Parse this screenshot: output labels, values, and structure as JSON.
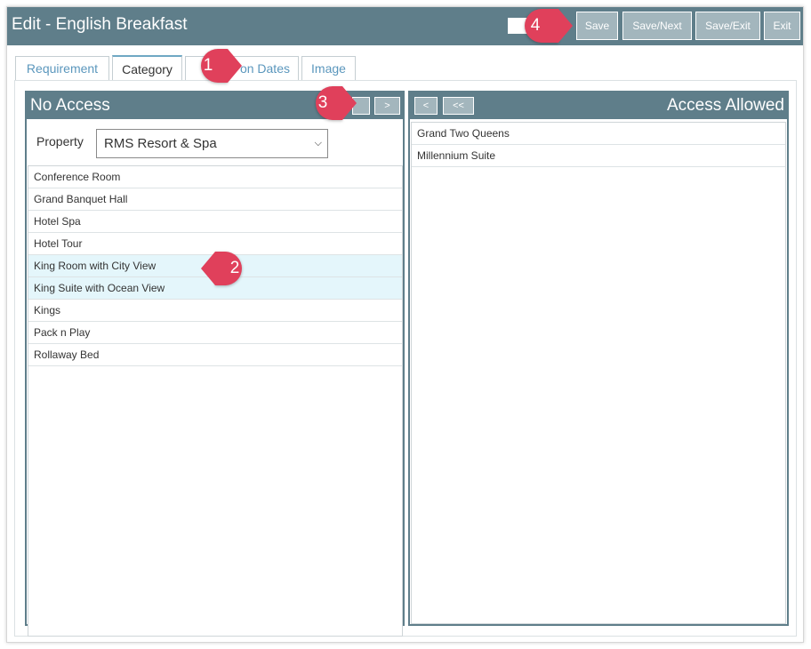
{
  "window": {
    "title": "Edit - English Breakfast",
    "buttons": {
      "save": "Save",
      "save_next": "Save/Next",
      "save_exit": "Save/Exit",
      "exit": "Exit"
    }
  },
  "tabs": [
    {
      "label": "Requirement"
    },
    {
      "label": "Category"
    },
    {
      "label": "on Dates"
    },
    {
      "label": "Image"
    }
  ],
  "no_access": {
    "title": "No Access",
    "move_right_label": ">",
    "property_label": "Property",
    "property_value": "RMS Resort & Spa",
    "items": [
      "Conference Room",
      "Grand Banquet Hall",
      "Hotel Spa",
      "Hotel Tour",
      "King Room with City View",
      "King Suite with Ocean View",
      "Kings",
      "Pack n Play",
      "Rollaway Bed"
    ]
  },
  "access_allowed": {
    "title": "Access Allowed",
    "move_left_label": "<",
    "move_all_left_label": "<<",
    "items": [
      "Grand Two Queens",
      "Millennium Suite"
    ]
  },
  "callouts": {
    "c1": "1",
    "c2": "2",
    "c3": "3",
    "c4": "4"
  },
  "colors": {
    "header": "#5f7e8a",
    "button": "#a3b6bd",
    "callout": "#e0405b",
    "selected_row": "#e4f6fb"
  }
}
